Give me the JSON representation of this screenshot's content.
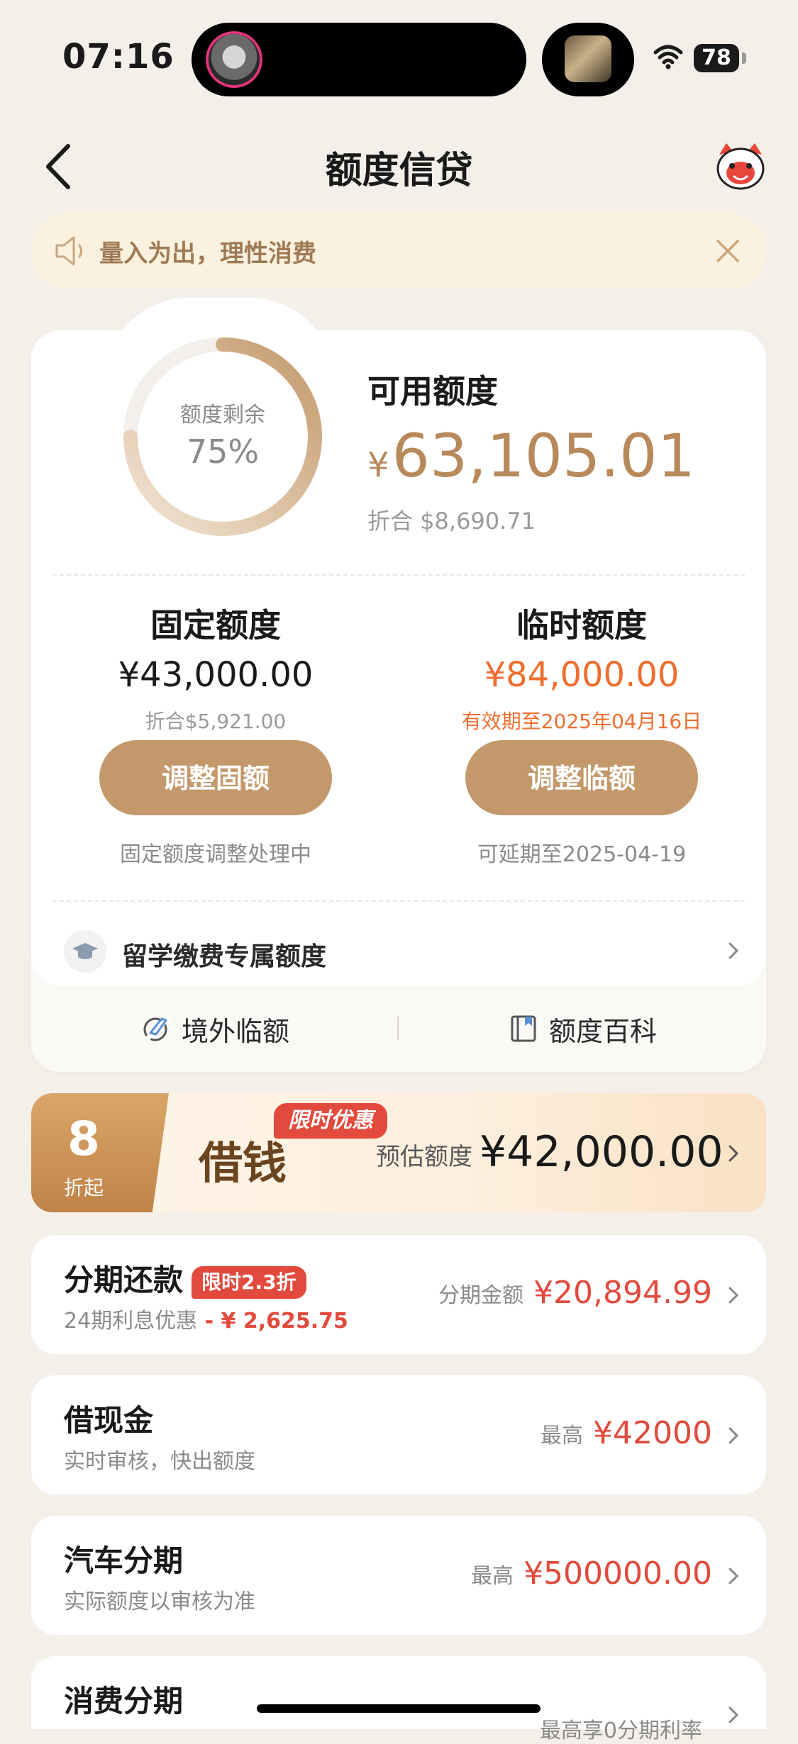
{
  "status": {
    "time": "07:16",
    "battery": "78"
  },
  "header": {
    "title": "额度信贷"
  },
  "notice": {
    "text": "量入为出，理性消费"
  },
  "credit": {
    "ring_label": "额度剩余",
    "ring_percent": "75%",
    "ring_fraction": 0.75,
    "available_label": "可用额度",
    "currency": "¥",
    "available_amount": "63,105.01",
    "available_sub": "折合  $8,690.71",
    "fixed": {
      "title": "固定额度",
      "amount": "¥43,000.00",
      "sub": "折合$5,921.00",
      "button": "调整固额",
      "note": "固定额度调整处理中"
    },
    "temp": {
      "title": "临时额度",
      "amount": "¥84,000.00",
      "sub": "有效期至2025年04月16日",
      "button": "调整临额",
      "note": "可延期至2025-04-19"
    },
    "study_label": "留学缴费专属额度",
    "quick_left": "境外临额",
    "quick_right": "额度百科"
  },
  "loan_banner": {
    "discount_num": "8",
    "discount_sub": "折起",
    "tag": "限时优惠",
    "title": "借钱",
    "est_label": "预估额度",
    "est_amount": "¥42,000.00"
  },
  "products": [
    {
      "title": "分期还款",
      "badge": "限时2.3折",
      "desc": "24期利息优惠",
      "desc_red": " - ¥ 2,625.75",
      "right_label": "分期金额",
      "right_value": "¥20,894.99"
    },
    {
      "title": "借现金",
      "desc": "实时审核，快出额度",
      "right_label": "最高",
      "right_value": "¥42000"
    },
    {
      "title": "汽车分期",
      "desc": "实际额度以审核为准",
      "right_label": "最高",
      "right_value": "¥500000.00"
    },
    {
      "title": "消费分期",
      "desc": "",
      "right_label": "最高享0分期利率",
      "right_value": ""
    }
  ],
  "colors": {
    "accent": "#c3996b",
    "gold_text": "#b8895b",
    "orange": "#ee6e2f",
    "red": "#e14a3c",
    "page_bg": "#f4efe9"
  }
}
